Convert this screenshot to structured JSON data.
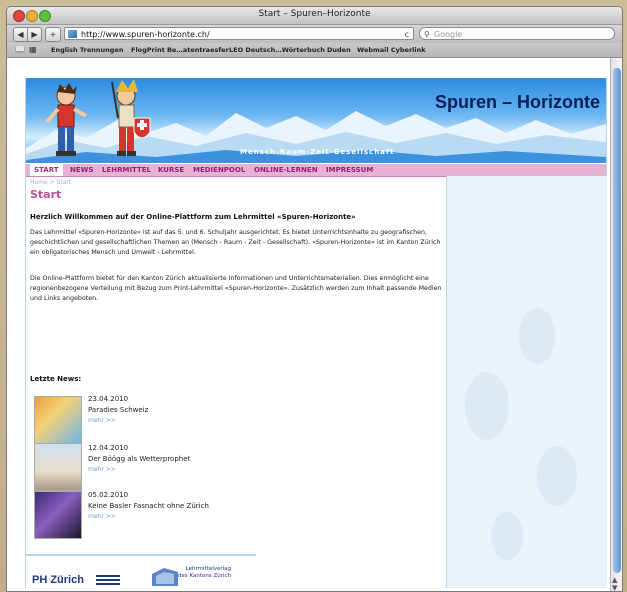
{
  "window": {
    "title": "Start – Spuren–Horizonte"
  },
  "toolbar": {
    "back_label": "◀",
    "forward_label": "▶",
    "add_label": "+",
    "url": "http://www.spuren-horizonte.ch/",
    "reload_label": "c",
    "search_placeholder": "Google"
  },
  "bookmarks": {
    "items": [
      "English Trennungen",
      "FlogPrint Be…atentraesfer",
      "LEO Deutsch…Wörterbuch",
      "Duden",
      "Webmail Cyberlink"
    ]
  },
  "site": {
    "title": "Spuren – Horizonte",
    "subtitle": "Mensch-Raum-Zeit-Gesellschaft",
    "nav": [
      "START",
      "NEWS",
      "LEHRMITTEL",
      "KURSE",
      "MEDIENPOOL",
      "ONLINE-LERNEN",
      "IMPRESSUM"
    ],
    "active_nav": "START",
    "breadcrumb": "Home > Start",
    "page_title": "Start",
    "welcome_heading": "Herzlich Willkommen auf der Online-Plattform zum Lehrmittel «Spuren-Horizonte»",
    "para1": "Das Lehrmittel «Spuren-Horizonte» ist auf das 5. und 6. Schuljahr ausgerichtet. Es bietet Unterrichtsinhalte zu geografischen, geschichtlichen und gesellschaftlichen Themen an (Mensch - Raum - Zeit - Gesellschaft). «Spuren-Horizonte» ist im Kanton Zürich ein obligatorisches Mensch und Umwelt - Lehrmittel.",
    "para2": "Die Online-Plattform bietet für den Kanton Zürich aktualisierte Informationen und Unterrichtsmaterialien. Dies ermöglicht eine regionenbezogene Verteilung mit Bezug zum Print-Lehrmittel «Spuren-Horizonte». Zusätzlich werden zum Inhalt passende  Medien und Links angeboten.",
    "news_heading": "Letzte News:",
    "news": [
      {
        "date": "23.04.2010",
        "title": "Paradies Schweiz",
        "more": "mehr >>"
      },
      {
        "date": "12.04.2010",
        "title": "Der Böögg als Wetterprophet",
        "more": "mehr >>"
      },
      {
        "date": "05.02.2010",
        "title": "Keine Basler Fasnacht ohne Zürich",
        "more": "mehr >>"
      }
    ],
    "footer": {
      "phz": "PH Zürich",
      "lmv_line1": "Lehrmittelverlag",
      "lmv_line2": "des Kantons Zürich"
    }
  },
  "colors": {
    "accent": "#c0509b",
    "nav_bg": "#e7b3d4",
    "banner_blue": "#2a8be0"
  }
}
